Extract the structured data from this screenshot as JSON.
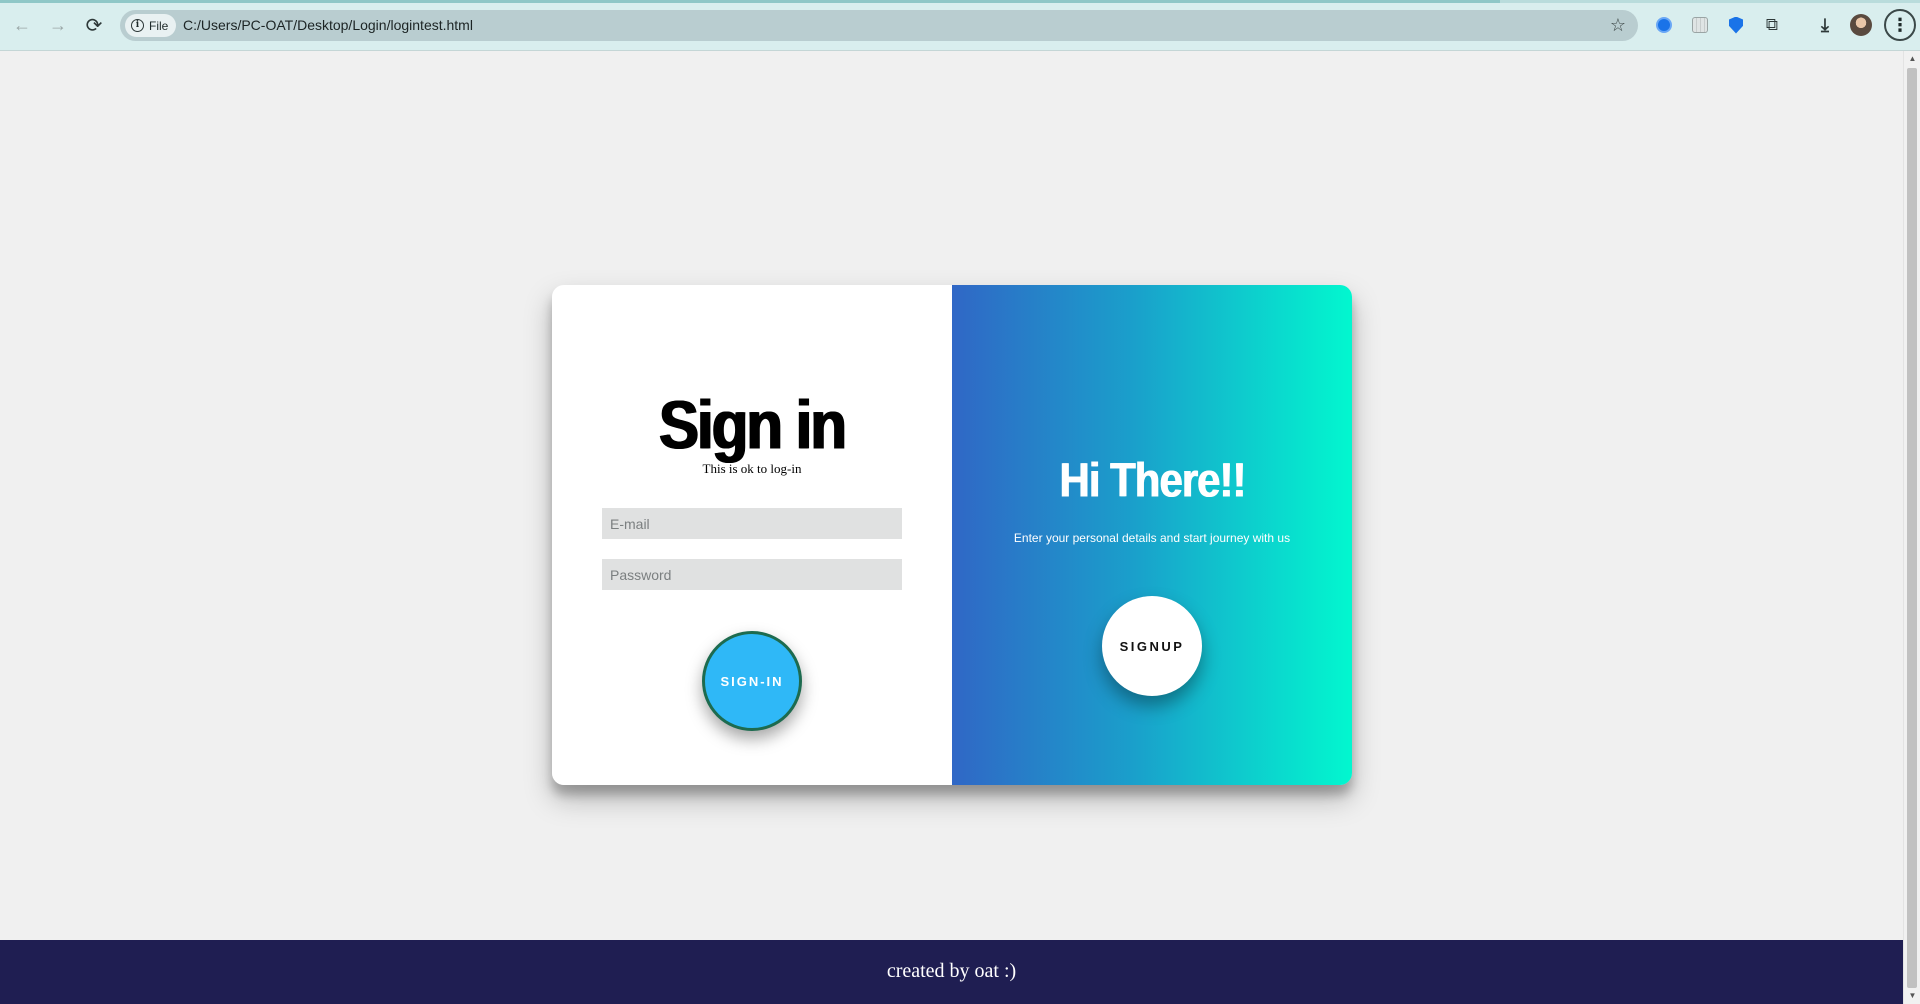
{
  "browser": {
    "site_chip_label": "File",
    "url": "C:/Users/PC-OAT/Desktop/Login/logintest.html",
    "icons": {
      "back": "←",
      "forward": "→",
      "reload": "⟳",
      "star": "☆",
      "puzzle": "⧉",
      "download": "⤓",
      "menu": "⋮",
      "info": "i"
    }
  },
  "signin_panel": {
    "title": "Sign in",
    "subtitle": "This is ok to log-in",
    "email_placeholder": "E-mail",
    "password_placeholder": "Password",
    "button_label": "SIGN-IN"
  },
  "signup_panel": {
    "title": "Hi There!!",
    "subtitle": "Enter your personal details and start journey with us",
    "button_label": "SIGNUP"
  },
  "footer": {
    "text": "created by oat :)"
  },
  "colors": {
    "page_bg": "#f0f0f0",
    "gradient_start": "#3067c6",
    "gradient_end": "#02f7cf",
    "signin_button": "#2fb8f7",
    "footer_bg": "#1f1e52"
  }
}
